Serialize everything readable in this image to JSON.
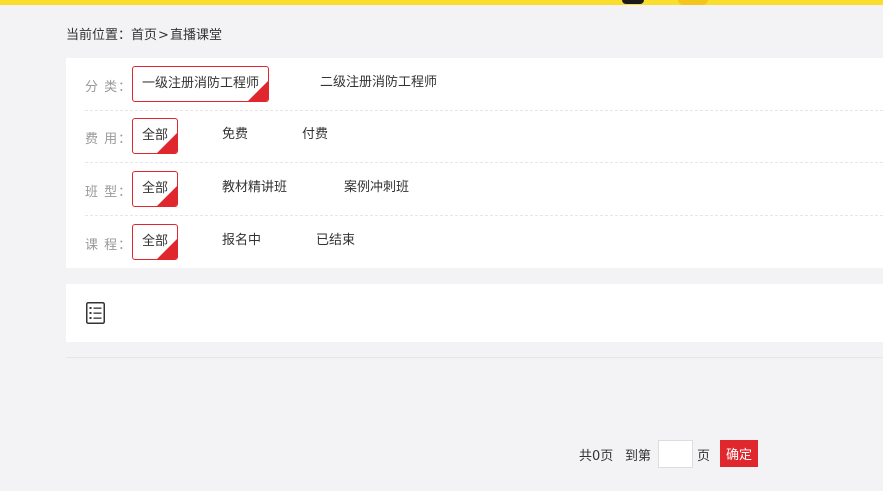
{
  "breadcrumb": {
    "prefix": "当前位置：",
    "home": "首页",
    "separator": ">",
    "current": "直播课堂"
  },
  "filters": [
    {
      "label": "分 类：",
      "options": [
        "一级注册消防工程师",
        "二级注册消防工程师"
      ],
      "selected": "一级注册消防工程师"
    },
    {
      "label": "费 用：",
      "options": [
        "全部",
        "免费",
        "付费"
      ],
      "selected": "全部"
    },
    {
      "label": "班 型：",
      "options": [
        "全部",
        "教材精讲班",
        "案例冲刺班"
      ],
      "selected": "全部"
    },
    {
      "label": "课 程：",
      "options": [
        "全部",
        "报名中",
        "已结束"
      ],
      "selected": "全部"
    }
  ],
  "list": {
    "icon": "list-icon"
  },
  "pager": {
    "total_text": "共0页",
    "goto_text": "到第",
    "page_input_value": "",
    "page_unit": "页",
    "confirm_label": "确定"
  },
  "colors": {
    "accent": "#e0272d",
    "top_bar": "#f9de2d",
    "background": "#f3f3f5"
  }
}
